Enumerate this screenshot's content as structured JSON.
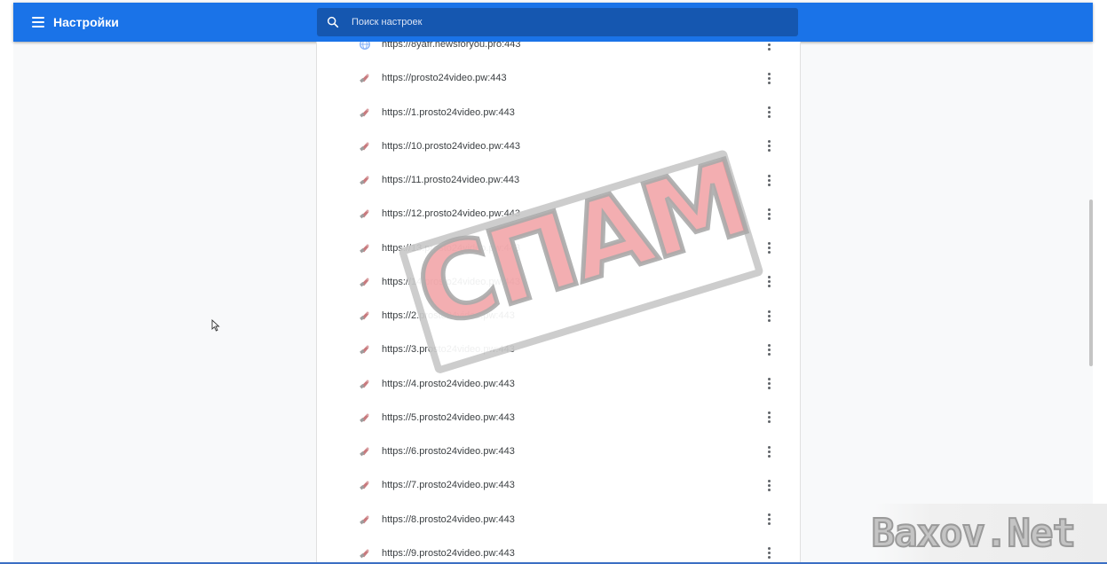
{
  "header": {
    "title": "Настройки",
    "search_placeholder": "Поиск настроек",
    "accent_color": "#1a73e8"
  },
  "sites": [
    {
      "url": "https://8yafr.newsforyou.pro:443",
      "icon": "globe-icon"
    },
    {
      "url": "https://prosto24video.pw:443",
      "icon": "site-favicon"
    },
    {
      "url": "https://1.prosto24video.pw:443",
      "icon": "site-favicon"
    },
    {
      "url": "https://10.prosto24video.pw:443",
      "icon": "site-favicon"
    },
    {
      "url": "https://11.prosto24video.pw:443",
      "icon": "site-favicon"
    },
    {
      "url": "https://12.prosto24video.pw:443",
      "icon": "site-favicon"
    },
    {
      "url": "https://13.prosto24video.pw:443",
      "icon": "site-favicon"
    },
    {
      "url": "https://14.prosto24video.pw:443",
      "icon": "site-favicon"
    },
    {
      "url": "https://2.prosto24video.pw:443",
      "icon": "site-favicon"
    },
    {
      "url": "https://3.prosto24video.pw:443",
      "icon": "site-favicon"
    },
    {
      "url": "https://4.prosto24video.pw:443",
      "icon": "site-favicon"
    },
    {
      "url": "https://5.prosto24video.pw:443",
      "icon": "site-favicon"
    },
    {
      "url": "https://6.prosto24video.pw:443",
      "icon": "site-favicon"
    },
    {
      "url": "https://7.prosto24video.pw:443",
      "icon": "site-favicon"
    },
    {
      "url": "https://8.prosto24video.pw:443",
      "icon": "site-favicon"
    },
    {
      "url": "https://9.prosto24video.pw:443",
      "icon": "site-favicon"
    }
  ],
  "overlay": {
    "stamp_text": "СПАМ",
    "watermark": "Baxov.Net"
  }
}
